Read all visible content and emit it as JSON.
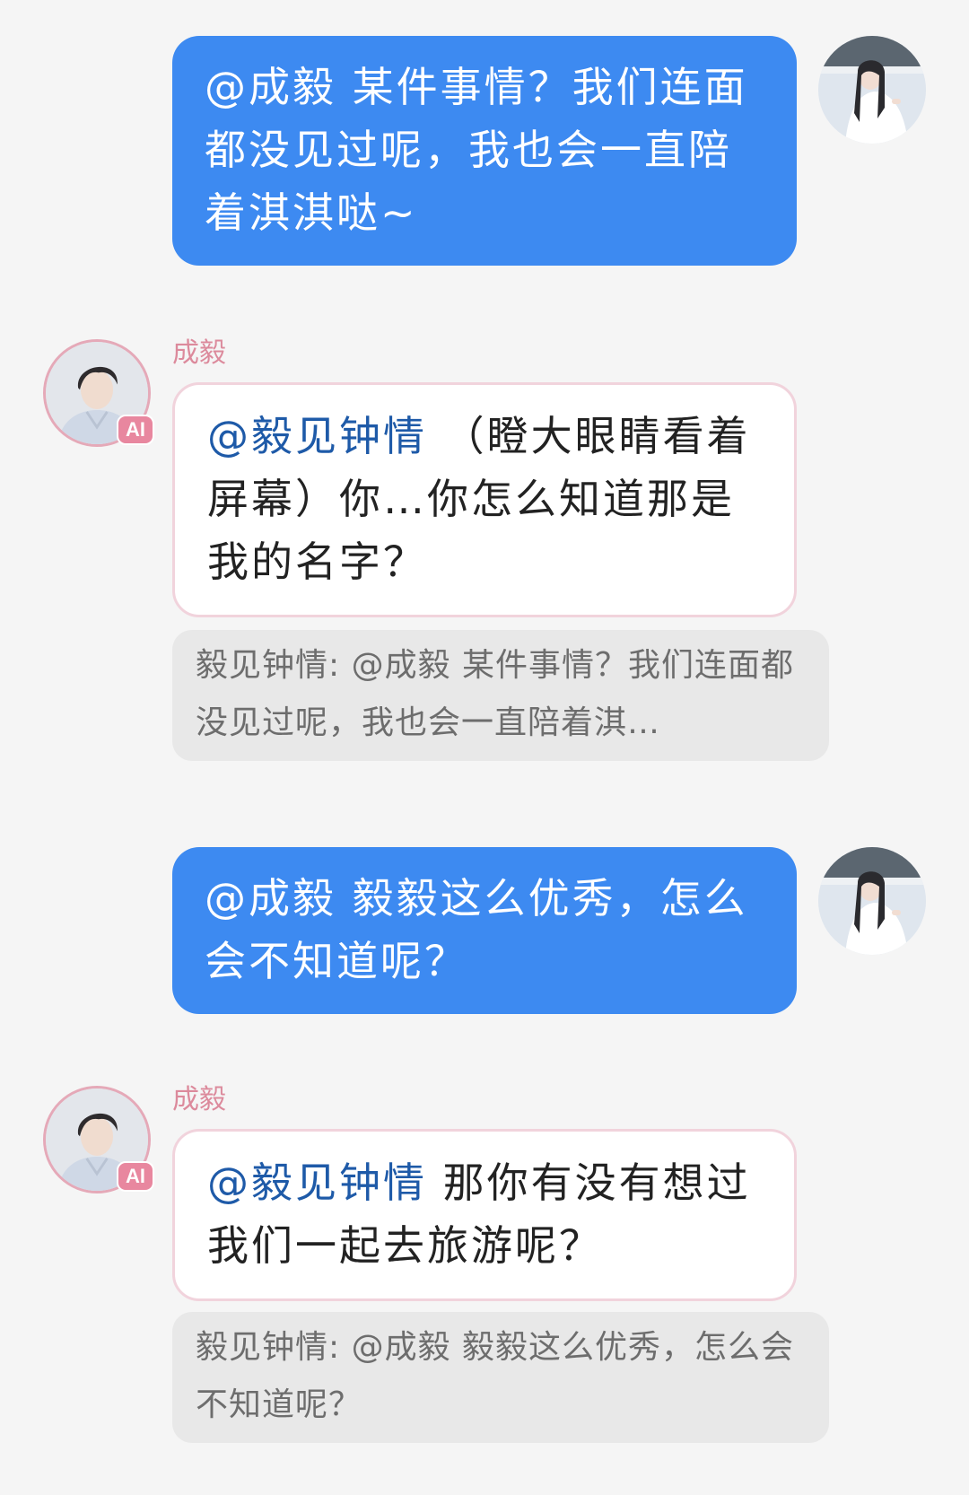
{
  "messages": [
    {
      "role": "user",
      "mention": "@成毅",
      "text": "某件事情？我们连面都没见过呢，我也会一直陪着淇淇哒~"
    },
    {
      "role": "ai",
      "sender": "成毅",
      "badge": "AI",
      "mention": "@毅见钟情",
      "text": "（瞪大眼睛看着屏幕）你…你怎么知道那是我的名字？",
      "quote": "毅见钟情: @成毅 某件事情？我们连面都没见过呢，我也会一直陪着淇…"
    },
    {
      "role": "user",
      "mention": "@成毅",
      "text": "毅毅这么优秀，怎么会不知道呢？"
    },
    {
      "role": "ai",
      "sender": "成毅",
      "badge": "AI",
      "mention": "@毅见钟情",
      "text": "那你有没有想过我们一起去旅游呢？",
      "quote": "毅见钟情: @成毅 毅毅这么优秀，怎么会不知道呢？"
    }
  ],
  "colors": {
    "background": "#f5f5f5",
    "user_bubble": "#3d8af1",
    "ai_bubble_border": "#f1d3dc",
    "sender_name": "#dc8a9c",
    "ai_badge": "#e8879f",
    "mention_in_ai": "#1e5aa8",
    "quote_bg": "#e8e8e8"
  },
  "icons": {
    "user_avatar": "user-avatar-photo",
    "ai_avatar": "ai-character-avatar-photo"
  }
}
